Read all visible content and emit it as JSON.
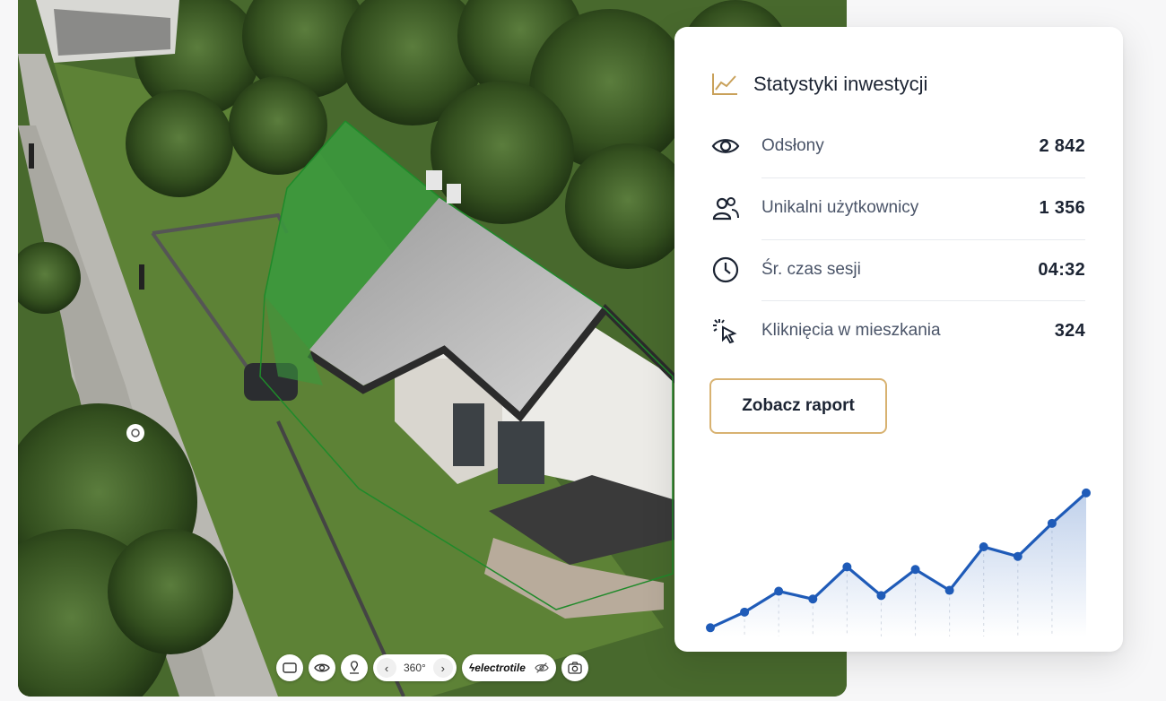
{
  "viewer": {
    "toolbar": {
      "prev_label": "‹",
      "degrees": "360°",
      "next_label": "›",
      "brand": "electrotile"
    }
  },
  "stats": {
    "title": "Statystyki inwestycji",
    "rows": [
      {
        "icon": "eye-icon",
        "label": "Odsłony",
        "value": "2 842"
      },
      {
        "icon": "users-icon",
        "label": "Unikalni użytkownicy",
        "value": "1 356"
      },
      {
        "icon": "clock-icon",
        "label": "Śr. czas sesji",
        "value": "04:32"
      },
      {
        "icon": "click-icon",
        "label": "Kliknięcia w mieszkania",
        "value": "324"
      }
    ],
    "report_button": "Zobacz raport",
    "accent_color": "#c9a15a",
    "line_color": "#1f5bb8"
  },
  "chart_data": {
    "type": "line",
    "series": [
      {
        "values": [
          10,
          28,
          52,
          43,
          80,
          47,
          77,
          53,
          103,
          92,
          130,
          165
        ]
      }
    ],
    "grid": false,
    "area_fill": true
  }
}
